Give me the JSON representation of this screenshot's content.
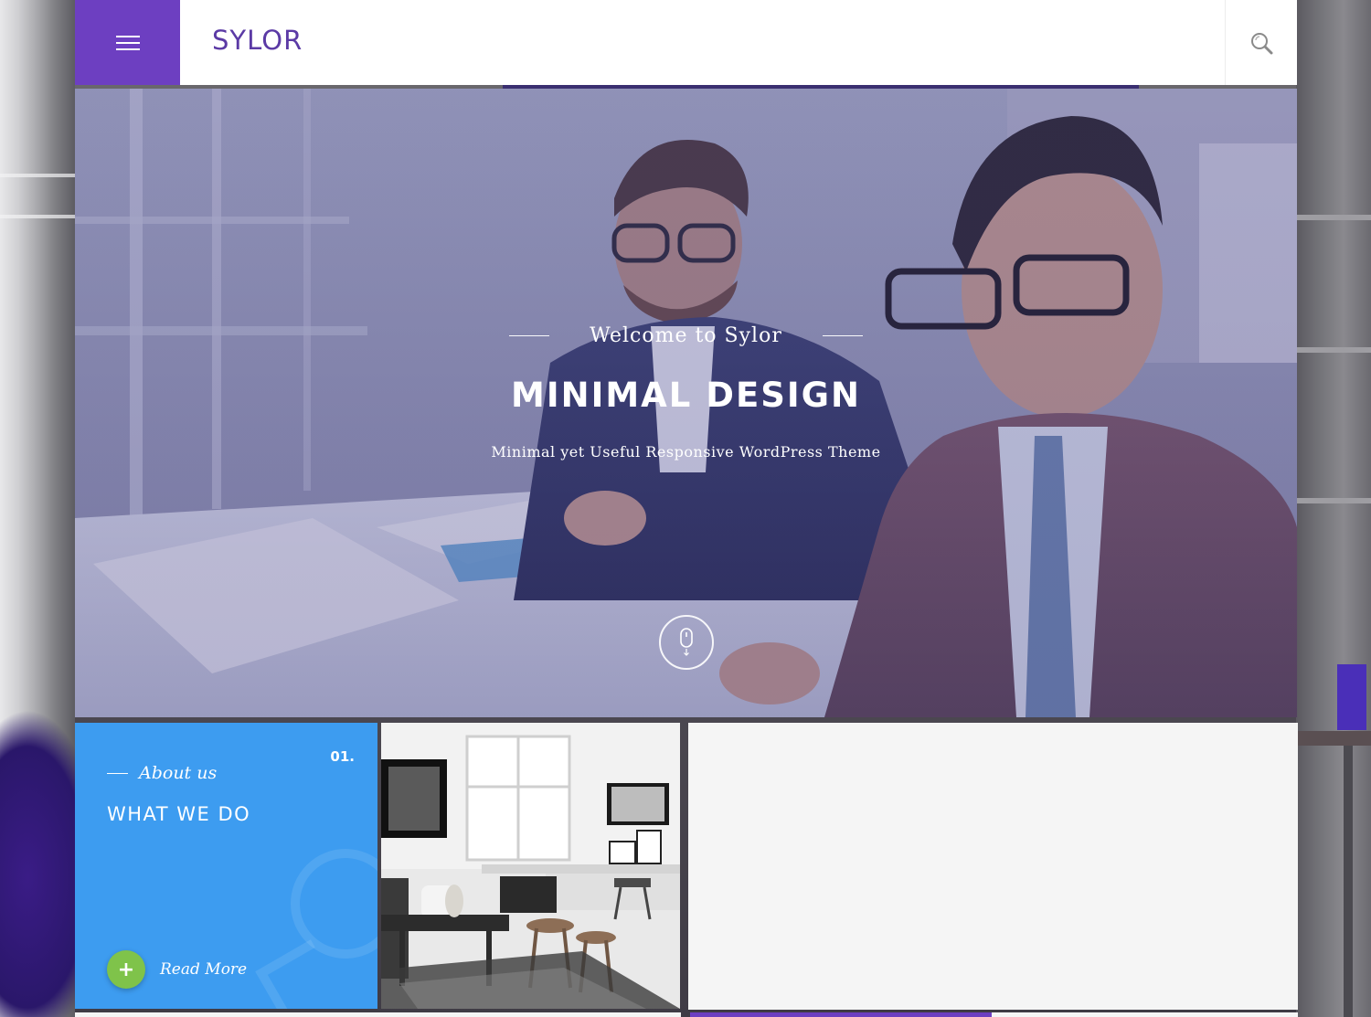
{
  "header": {
    "logo": "SYLOR",
    "menu_icon": "hamburger-icon",
    "search_icon": "search-icon"
  },
  "hero": {
    "welcome": "Welcome to Sylor",
    "title": "MINIMAL DESIGN",
    "subtitle": "Minimal yet Useful Responsive WordPress Theme",
    "scroll_icon": "mouse-scroll-icon"
  },
  "card_about": {
    "number": "01.",
    "eyebrow": "About us",
    "title": "WHAT WE DO",
    "read_more": "Read More",
    "plus_icon": "plus-icon"
  },
  "colors": {
    "brand_purple": "#6d3fc1",
    "logo_purple": "#5b3aa5",
    "card_blue": "#3d9cf0",
    "read_more_green": "#7fc34a",
    "panel_light": "#f5f5f5"
  }
}
